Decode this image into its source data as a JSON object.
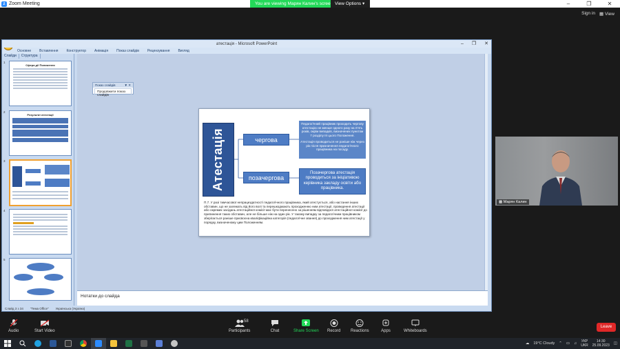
{
  "zoom": {
    "window_title": "Zoom Meeting",
    "viewing_banner": "You are viewing Марян Калин's screen",
    "view_options": "View Options",
    "sign_in": "Sign in",
    "view": "View"
  },
  "ppt": {
    "window_title": "атестація - Microsoft PowerPoint",
    "tabs": [
      "Основне",
      "Вставлення",
      "Конструктор",
      "Анімація",
      "Показ слайдів",
      "Рецензування",
      "Вигляд"
    ],
    "side_tabs": [
      "Слайди",
      "Структура"
    ],
    "popup_title": "Показ слайдів",
    "popup_button": "Продовжити показ слайдів",
    "notes_placeholder": "Нотатки до слайда",
    "status": [
      "Слайд 3 з 34",
      "\"Тема Office\"",
      "Українська (Україна)"
    ],
    "thumb_titles": [
      "Сфера дії Положення",
      "Результат атестації"
    ],
    "thumb_numbers": [
      "1",
      "2",
      "3",
      "4",
      "5"
    ],
    "slide": {
      "vertical_title": "Атестація",
      "cat1": "чергова",
      "cat2": "позачергова",
      "desc1a": "Педагогічний працівник проходить чергову атестацію не менше одного разу на п'ять років, окрім випадків, визначених пунктом 7 розділу ІІІ цього Положення.",
      "desc1b": "Атестація проводиться не раніше ніж через рік після призначення педагогічного працівника на посаду.",
      "desc2": "Позачергова атестація проводиться за ініціативою керівника закладу освіти або працівника.",
      "footnote": "П.7. У разі тимчасової непрацездатності педагогічного працівника, який атестується, або настання інших обставин, що не залежать від його волі та перешкоджають проходженню ним атестації, проведення атестації або окремих засідань атестаційної комісії має бути перенесено за рішенням відповідної атестаційної комісії до припинення таких обставин, але не більше ніж на один рік. У такому випадку за педагогічним працівником зберігається раніше присвоєна кваліфікаційна категорія (педагогічне звання) до проходження ним атестації у порядку, визначеному цим Положенням."
    }
  },
  "video": {
    "name": "Марян Калин"
  },
  "toolbar": {
    "audio": "Audio",
    "start_video": "Start Video",
    "participants": "Participants",
    "participants_count": "58",
    "chat": "Chat",
    "share": "Share Screen",
    "record": "Record",
    "reactions": "Reactions",
    "apps": "Apps",
    "whiteboards": "Whiteboards",
    "leave": "Leave"
  },
  "taskbar": {
    "weather": "19°C  Cloudy",
    "lang1": "УКР",
    "lang2": "UKR",
    "time": "14:30",
    "date": "25.09.2023"
  }
}
